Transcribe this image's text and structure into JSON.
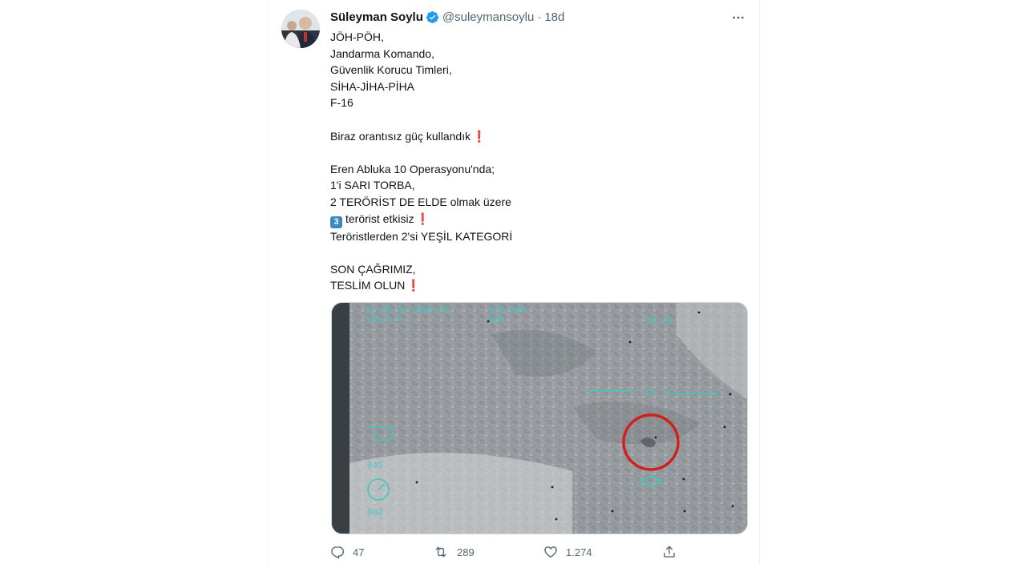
{
  "tweet": {
    "author": {
      "display_name": "Süleyman Soylu",
      "handle": "@suleymansoylu",
      "separator": "·",
      "time": "18d",
      "verified": true,
      "avatar_icon": "profile-photo"
    },
    "more_icon": "ellipsis-icon",
    "text": {
      "line1": "JÖH-PÖH,",
      "line2": "Jandarma Komando,",
      "line3": "Güvenlik Korucu Timleri,",
      "line4": "SİHA-JİHA-PİHA",
      "line5": "F-16",
      "line6": "Biraz orantısız güç kullandık",
      "line7": "Eren Abluka 10 Operasyonu'nda;",
      "line8": "1'i SARI TORBA,",
      "line9": "2 TERÖRİST DE ELDE olmak üzere",
      "line10_keycap": "3",
      "line10": "terörist etkisiz",
      "line11": "Teröristlerden 2'si YEŞİL KATEGORİ",
      "line12": "SON ÇAĞRIMIZ,",
      "line13": "TESLİM OLUN",
      "exclamation": "❗"
    },
    "media": {
      "description_icon": "drone-footage-image",
      "highlight_color": "#d01f1f",
      "hud_color": "#3fc7c2"
    },
    "actions": {
      "reply": {
        "icon": "reply-icon",
        "count": "47"
      },
      "retweet": {
        "icon": "retweet-icon",
        "count": "289"
      },
      "like": {
        "icon": "heart-icon",
        "count": "1.274"
      },
      "share": {
        "icon": "share-icon"
      }
    }
  }
}
